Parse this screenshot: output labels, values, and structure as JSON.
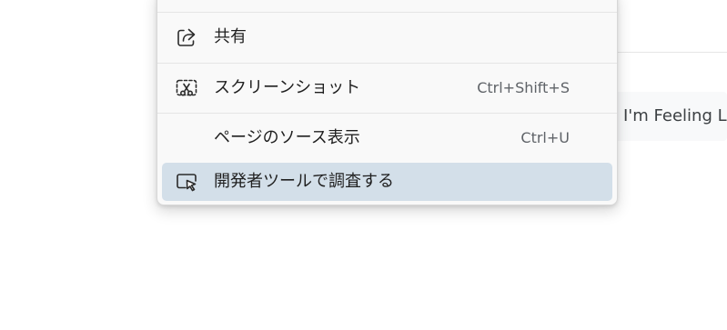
{
  "background": {
    "lucky_button_label": "I'm Feeling Lucky"
  },
  "context_menu": {
    "items": [
      {
        "label": "共有",
        "shortcut": "",
        "icon": "share-icon"
      },
      {
        "label": "スクリーンショット",
        "shortcut": "Ctrl+Shift+S",
        "icon": "screenshot-icon"
      },
      {
        "label": "ページのソース表示",
        "shortcut": "Ctrl+U",
        "icon": ""
      },
      {
        "label": "開発者ツールで調査する",
        "shortcut": "",
        "icon": "inspect-icon",
        "highlighted": true
      }
    ]
  },
  "colors": {
    "menu_background": "#f9f9f9",
    "highlight": "#d3dfe9",
    "text": "#1f1f1f",
    "shortcut_text": "#5f6368"
  }
}
